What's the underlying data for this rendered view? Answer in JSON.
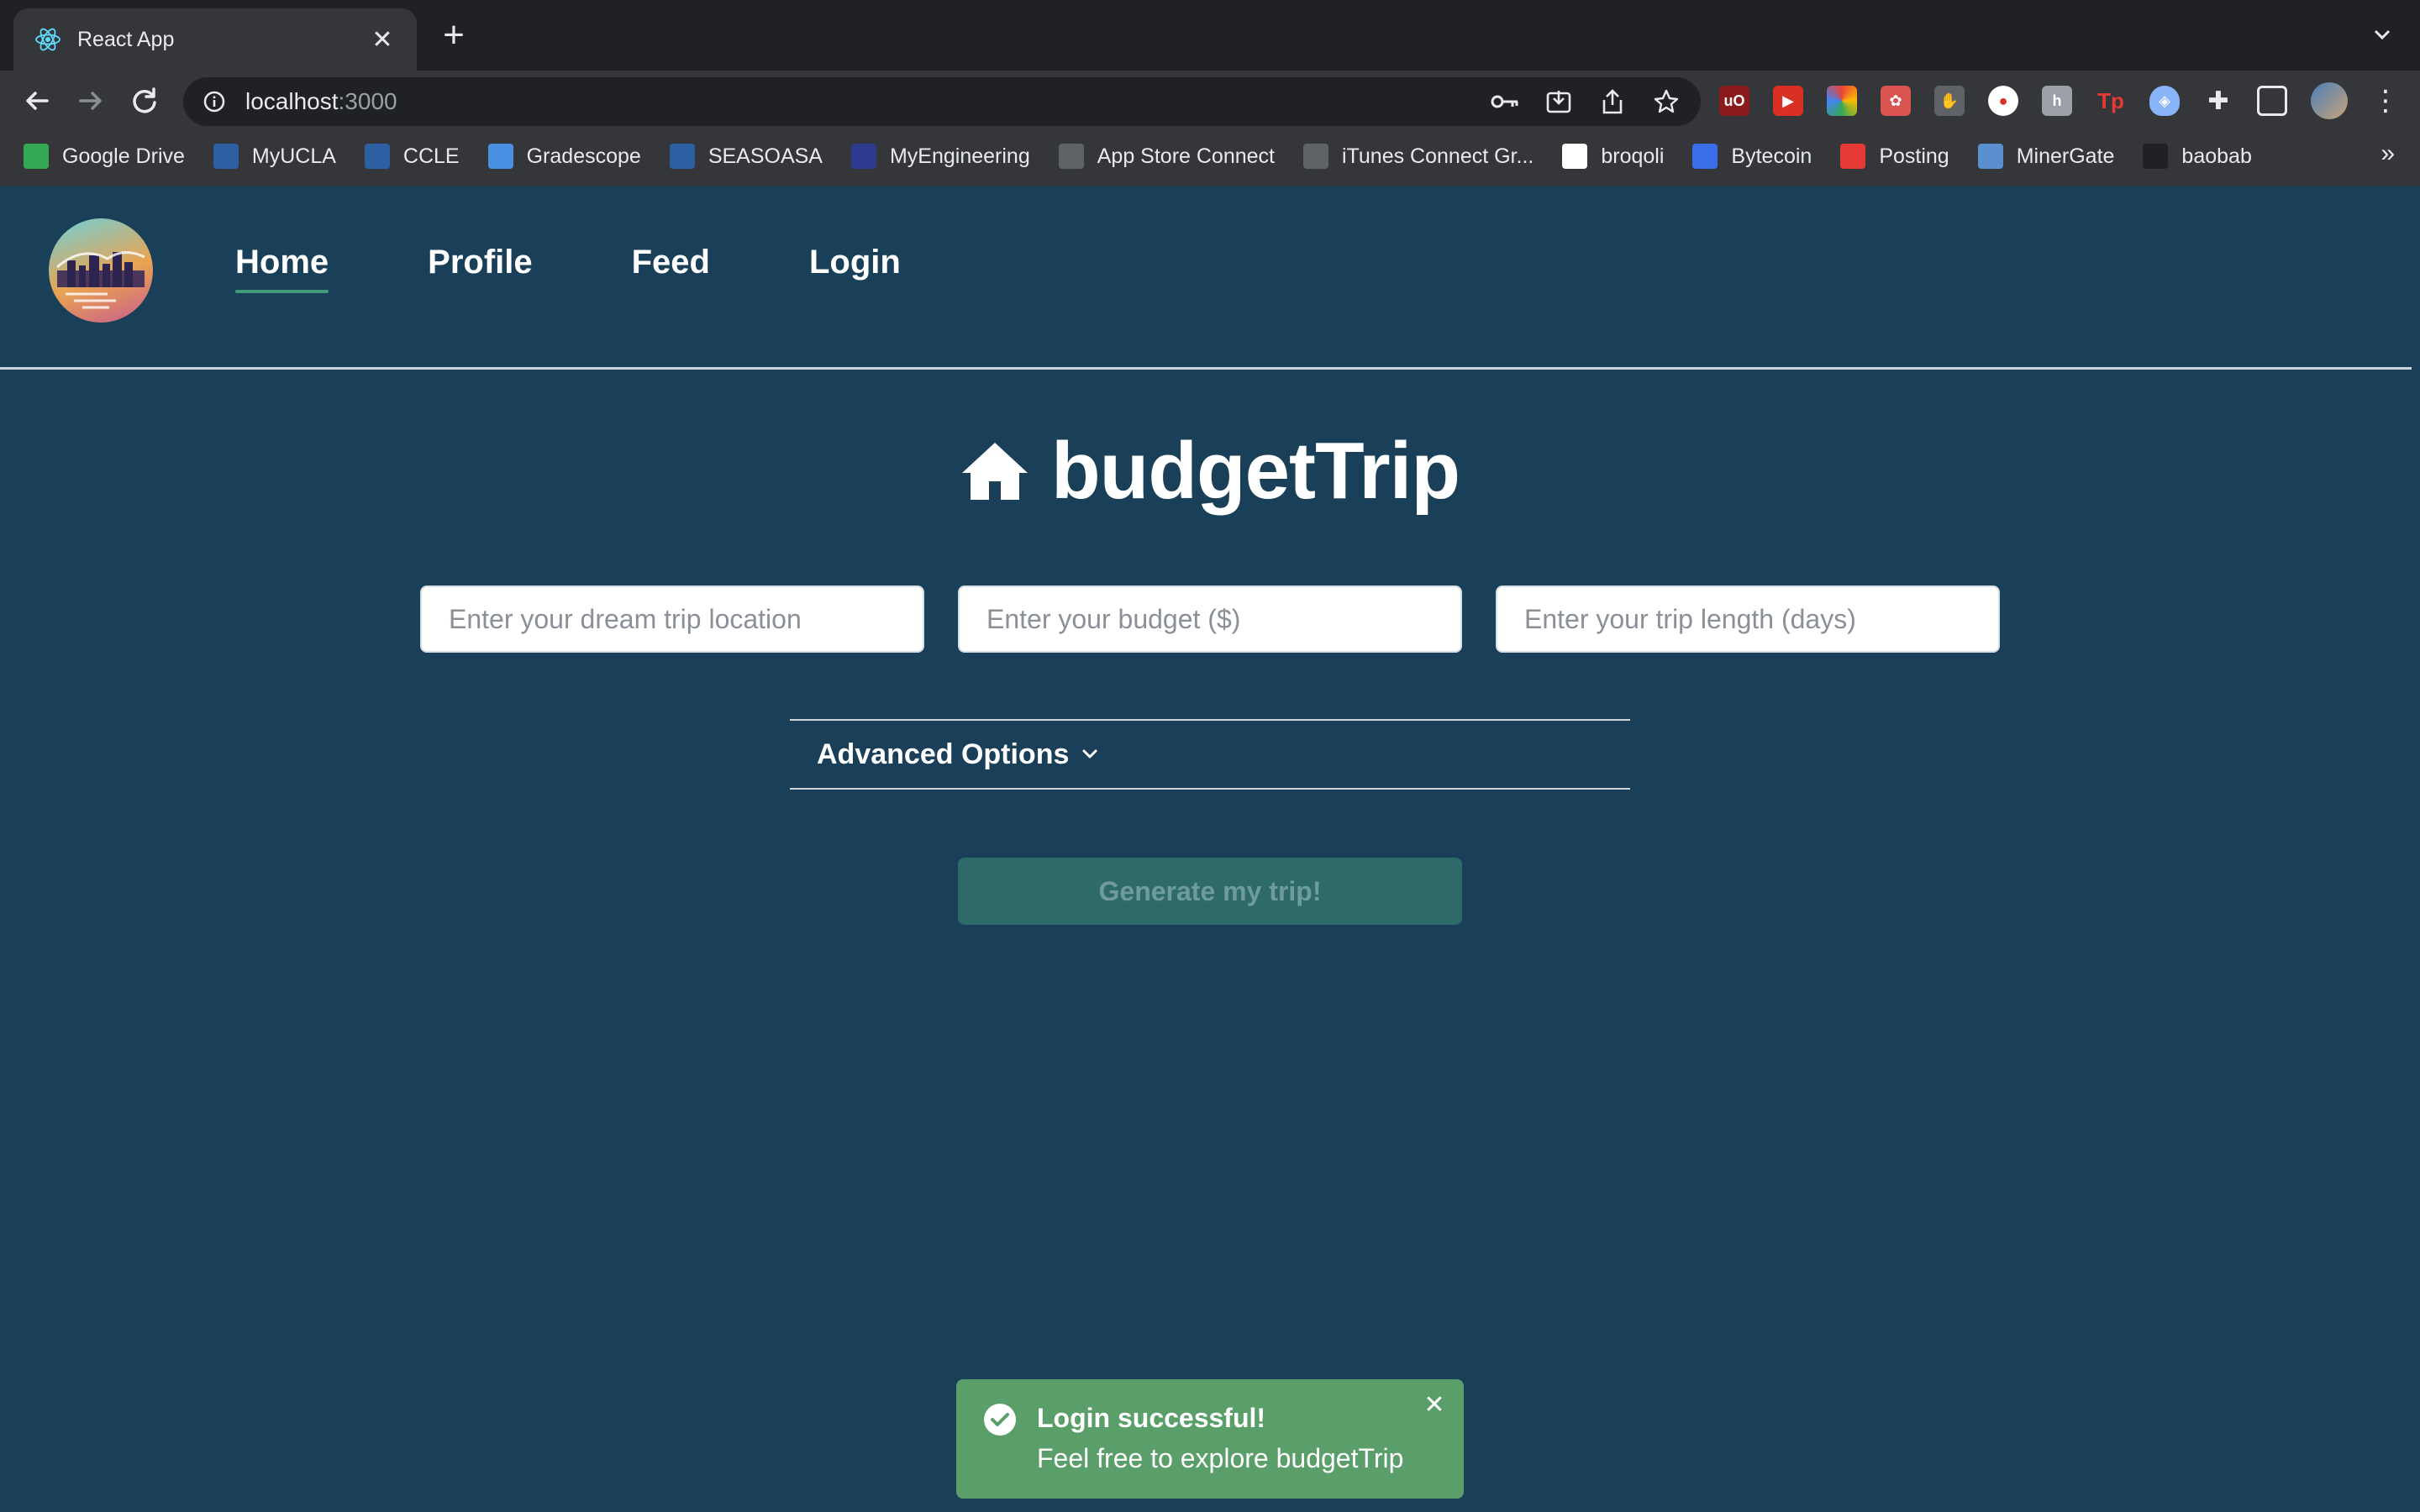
{
  "browser": {
    "tab_title": "React App",
    "url_host": "localhost",
    "url_port": ":3000",
    "bookmarks": [
      {
        "label": "Google Drive",
        "icon": "google-drive-icon",
        "color": "#34a853"
      },
      {
        "label": "MyUCLA",
        "icon": "ucla-icon",
        "color": "#2d5fa3"
      },
      {
        "label": "CCLE",
        "icon": "ucla-icon",
        "color": "#2d5fa3"
      },
      {
        "label": "Gradescope",
        "icon": "bar-chart-icon",
        "color": "#4a90e2"
      },
      {
        "label": "SEASOASA",
        "icon": "ucla-icon",
        "color": "#2d5fa3"
      },
      {
        "label": "MyEngineering",
        "icon": "ucla-icon",
        "color": "#2d3b8f"
      },
      {
        "label": "App Store Connect",
        "icon": "apple-icon",
        "color": "#5f6368"
      },
      {
        "label": "iTunes Connect Gr...",
        "icon": "apple-icon",
        "color": "#5f6368"
      },
      {
        "label": "broqoli",
        "icon": "broqoli-icon",
        "color": "#ffffff"
      },
      {
        "label": "Bytecoin",
        "icon": "bytecoin-icon",
        "color": "#3a6ee8"
      },
      {
        "label": "Posting",
        "icon": "posting-icon",
        "color": "#e53935"
      },
      {
        "label": "MinerGate",
        "icon": "minergate-icon",
        "color": "#5a8fd0"
      },
      {
        "label": "baobab",
        "icon": "baobab-icon",
        "color": "#202124"
      }
    ],
    "bookmarks_more": "»"
  },
  "nav": {
    "items": [
      {
        "label": "Home",
        "active": true
      },
      {
        "label": "Profile",
        "active": false
      },
      {
        "label": "Feed",
        "active": false
      },
      {
        "label": "Login",
        "active": false
      }
    ]
  },
  "hero": {
    "title": "budgetTrip",
    "icon": "home-icon"
  },
  "form": {
    "location_placeholder": "Enter your dream trip location",
    "budget_placeholder": "Enter your budget ($)",
    "length_placeholder": "Enter your trip length (days)",
    "advanced_label": "Advanced Options",
    "generate_label": "Generate my trip!"
  },
  "toast": {
    "title": "Login successful!",
    "description": "Feel free to explore budgetTrip",
    "color": "#5a9e69"
  },
  "colors": {
    "background": "#1a4059",
    "accent": "#3f9c7b"
  }
}
